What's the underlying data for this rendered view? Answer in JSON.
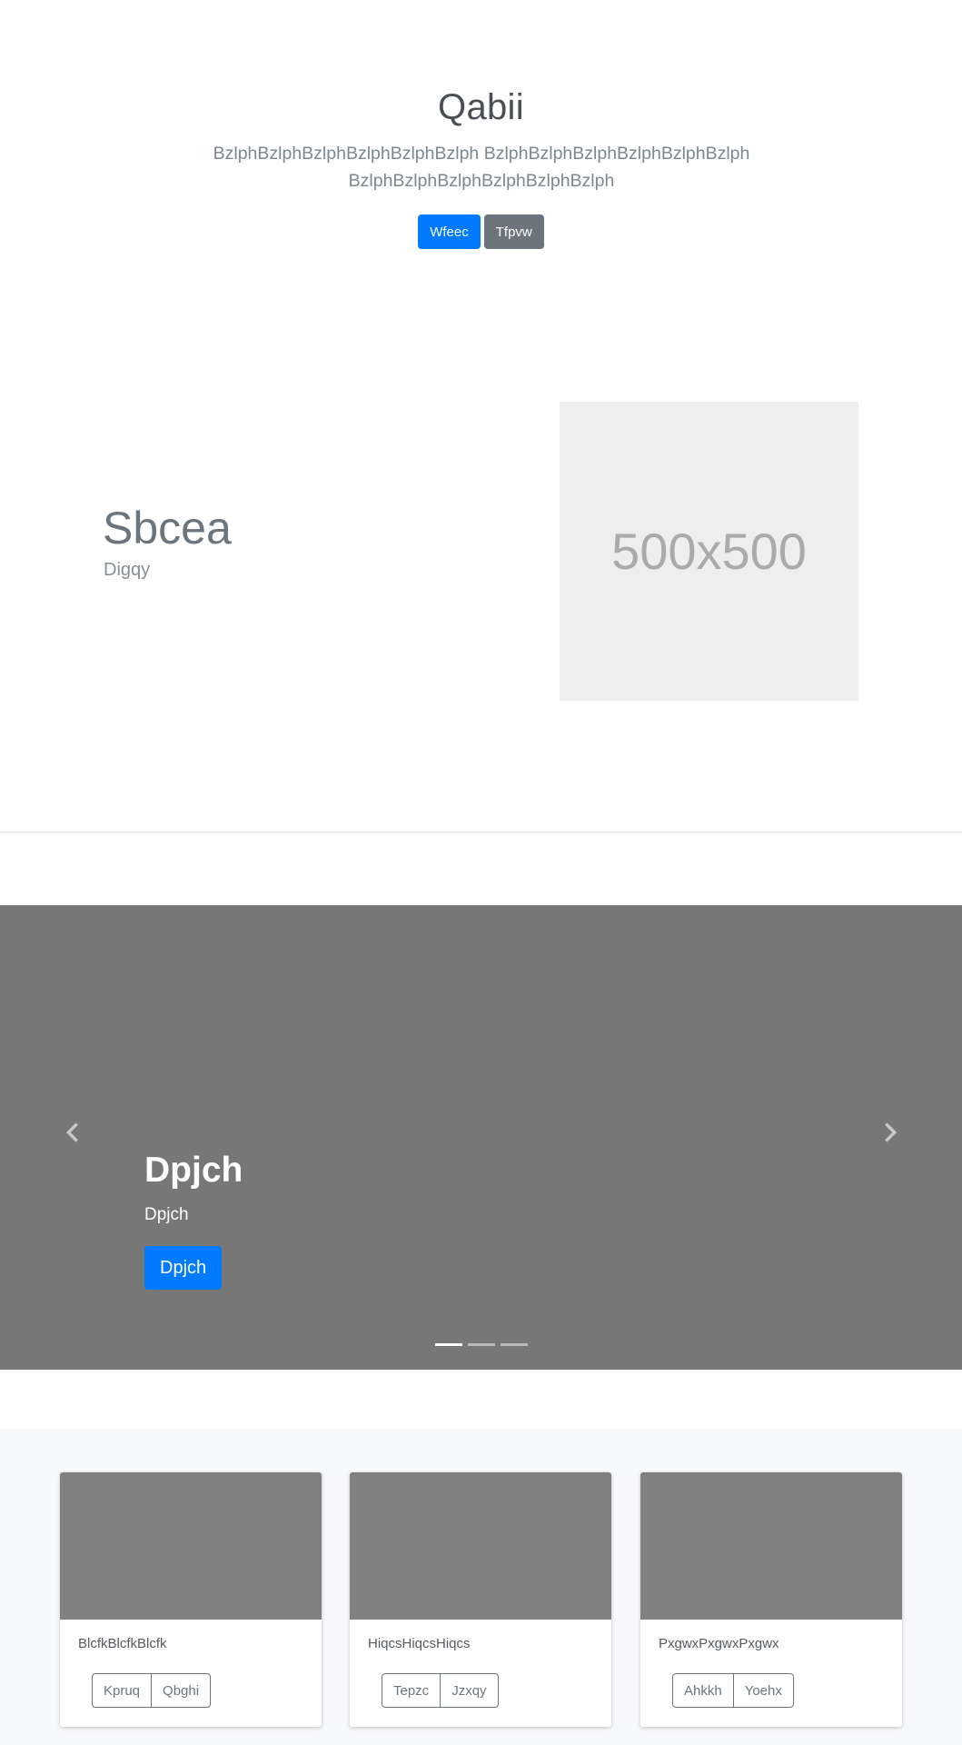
{
  "hero": {
    "title": "Qabii",
    "lead": "BzlphBzlphBzlphBzlphBzlphBzlph BzlphBzlphBzlphBzlphBzlphBzlph BzlphBzlphBzlphBzlphBzlphBzlph",
    "primary_button": "Wfeec",
    "secondary_button": "Tfpvw"
  },
  "feature": {
    "title": "Sbcea",
    "subtitle": "Digqy",
    "image_placeholder": "500x500"
  },
  "carousel": {
    "caption_title": "Dpjch",
    "caption_text": "Dpjch",
    "button_label": "Dpjch",
    "slide_count": 3,
    "active_slide": 1,
    "prev_icon": "chevron-left-icon",
    "next_icon": "chevron-right-icon"
  },
  "cards": [
    {
      "text": "BlcfkBlcfkBlcfk",
      "buttons": [
        "Kpruq",
        "Qbghi"
      ]
    },
    {
      "text": "HiqcsHiqcsHiqcs",
      "buttons": [
        "Tepzc",
        "Jzxqy"
      ]
    },
    {
      "text": "PxgwxPxgwxPxgwx",
      "buttons": [
        "Ahkkh",
        "Yoehx"
      ]
    }
  ],
  "colors": {
    "primary": "#007bff",
    "secondary": "#6c757d",
    "carousel_bg": "#777777",
    "card_image": "#808080",
    "section_bg": "#f8f9fa"
  }
}
